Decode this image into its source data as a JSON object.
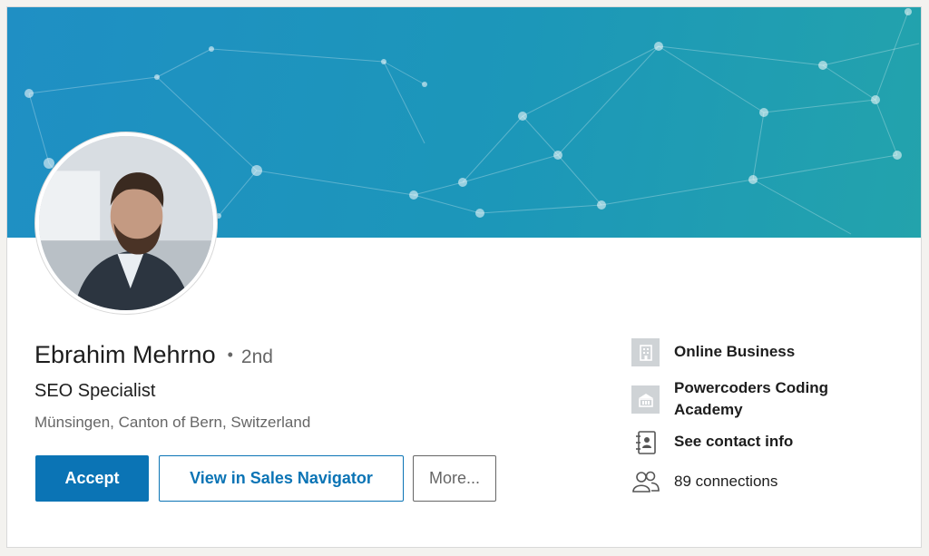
{
  "profile": {
    "name": "Ebrahim Mehrno",
    "separator": "•",
    "degree": "2nd",
    "headline": "SEO Specialist",
    "location": "Münsingen, Canton of Bern, Switzerland"
  },
  "actions": {
    "accept_label": "Accept",
    "sales_navigator_label": "View in Sales Navigator",
    "more_label": "More..."
  },
  "sidebar": {
    "current_company": "Online Business",
    "education_line1": "Powercoders Coding",
    "education_line2": "Academy",
    "contact_info": "See contact info",
    "connections": "89 connections"
  },
  "colors": {
    "primary_blue": "#0b74b5",
    "banner_start": "#1f8fc4",
    "banner_end": "#23a3ac"
  },
  "icons": {
    "company": "building-icon",
    "education": "school-icon",
    "contact": "contact-book-icon",
    "connections": "people-icon"
  }
}
